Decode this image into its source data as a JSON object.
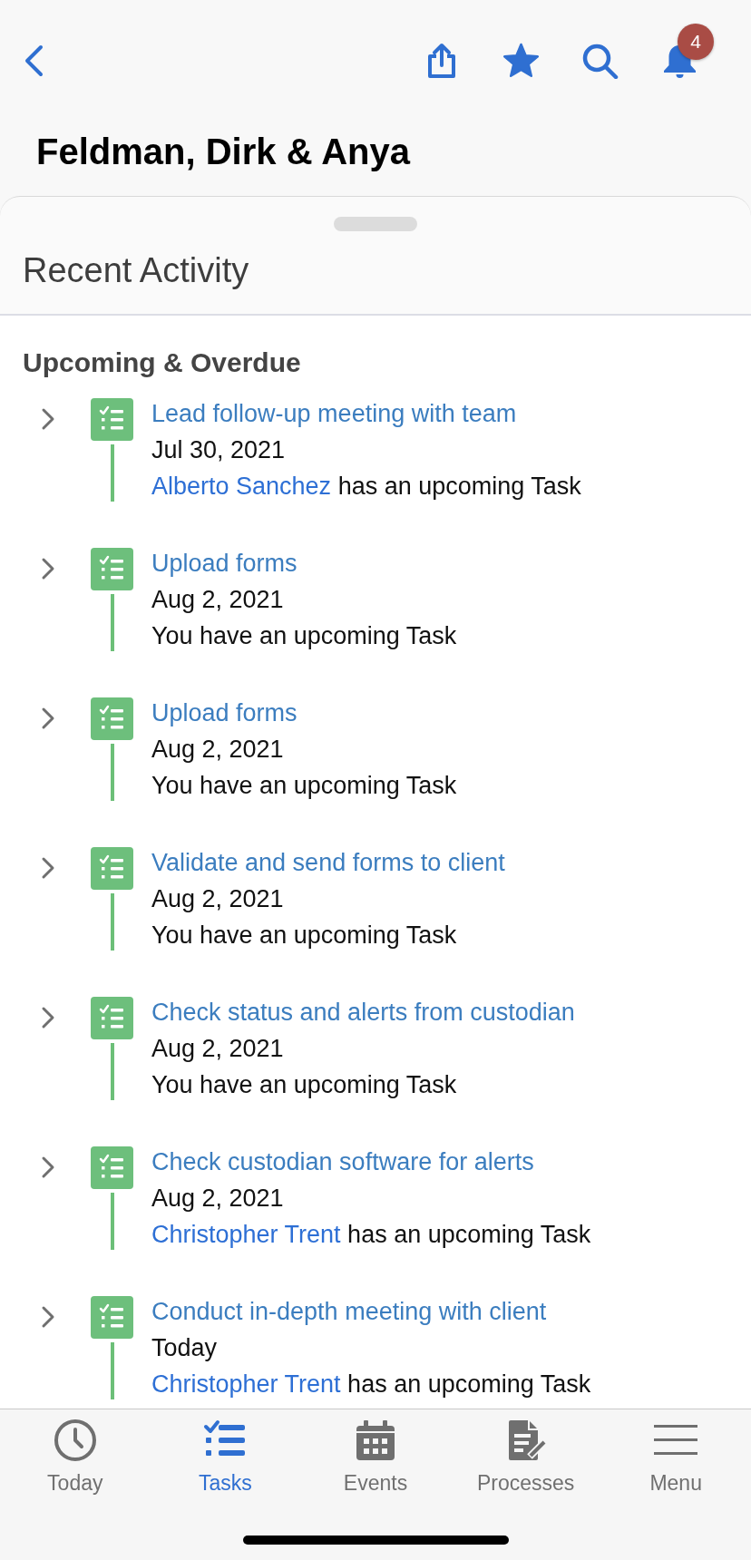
{
  "nav": {
    "starred": true,
    "badge": "4"
  },
  "title": "Feldman, Dirk & Anya",
  "sheet": {
    "title": "Recent Activity"
  },
  "section": {
    "title": "Upcoming & Overdue",
    "items": [
      {
        "title": "Lead follow-up meeting with team",
        "date": "Jul 30, 2021",
        "person": "Alberto Sanchez",
        "text": "has an upcoming Task",
        "expanded": false
      },
      {
        "title": "Upload forms",
        "date": "Aug 2, 2021",
        "text": "You have an upcoming Task",
        "expanded": false
      },
      {
        "title": "Upload forms",
        "date": "Aug 2, 2021",
        "text": "You have an upcoming Task",
        "expanded": false
      },
      {
        "title": "Validate and send forms to client",
        "date": "Aug 2, 2021",
        "text": "You have an upcoming Task",
        "expanded": false
      },
      {
        "title": "Check status and alerts from custodian",
        "date": "Aug 2, 2021",
        "text": "You have an upcoming Task",
        "expanded": false
      },
      {
        "title": "Check custodian software for alerts",
        "date": "Aug 2, 2021",
        "person": "Christopher Trent",
        "text": "has an upcoming Task",
        "expanded": false
      },
      {
        "title": "Conduct in-depth meeting with client",
        "date": "Today",
        "person": "Christopher Trent",
        "text": "has an upcoming Task",
        "expanded": false
      }
    ]
  },
  "tab_bar": [
    {
      "label": "Today",
      "selected": false
    },
    {
      "label": "Tasks",
      "selected": true
    },
    {
      "label": "Events",
      "selected": false
    },
    {
      "label": "Processes",
      "selected": false
    },
    {
      "label": "Menu",
      "selected": false
    }
  ]
}
